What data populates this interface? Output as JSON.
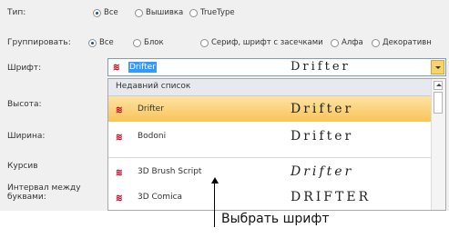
{
  "labels": {
    "type": "Тип:",
    "group": "Группировать:",
    "font": "Шрифт:",
    "height": "Высота:",
    "width": "Ширина:",
    "italic": "Курсив",
    "spacing_line1": "Интервал между",
    "spacing_line2": "буквами:"
  },
  "type_options": [
    "Все",
    "Вышивка",
    "TrueType"
  ],
  "type_selected": "Все",
  "group_options": [
    "Все",
    "Блок",
    "Сериф, шрифт с засечками",
    "Алфа",
    "Декоративн"
  ],
  "group_selected": "Все",
  "font_combo": {
    "value": "Drifter",
    "preview": "Drifter"
  },
  "list": {
    "header": "Недавний список",
    "items": [
      {
        "name": "Drifter",
        "preview": "Drifter",
        "selected": true
      },
      {
        "name": "Bodoni",
        "preview": "Drifter",
        "selected": false
      },
      {
        "name": "3D Brush Script",
        "preview": "Drifter",
        "selected": false
      },
      {
        "name": "3D Comica",
        "preview": "DRIFTER",
        "selected": false
      }
    ]
  },
  "icons": {
    "font_type": "embroidery-font-icon",
    "dropdown": "chevron-down-icon",
    "scroll_up": "arrow-up-icon"
  },
  "colors": {
    "selection": "#3399ff",
    "highlight": "#f9c458",
    "font_icon": "#c8102e"
  },
  "callout": "Выбрать шрифт"
}
